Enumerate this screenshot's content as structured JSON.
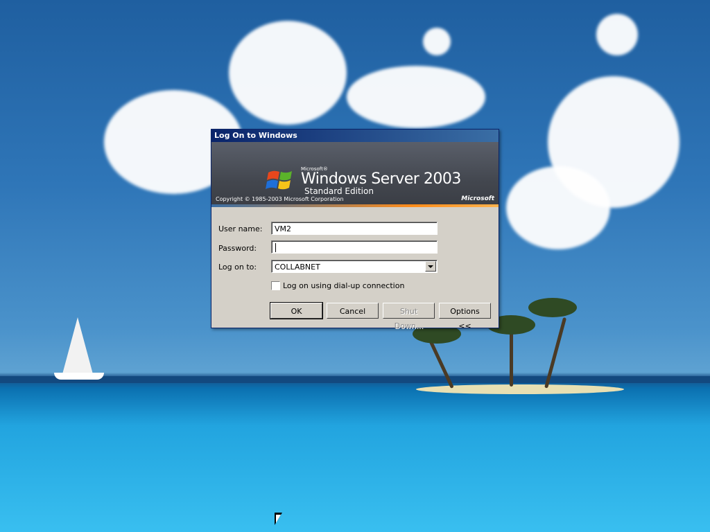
{
  "desktop": {
    "wallpaper": "tropical-island-bliss"
  },
  "dialog": {
    "title": "Log On to Windows",
    "banner": {
      "microsoft_small": "Microsoft®",
      "product": "Windows Server 2003",
      "edition": "Standard Edition",
      "copyright": "Copyright © 1985-2003  Microsoft Corporation",
      "brand": "Microsoft"
    },
    "fields": {
      "username_label": "User name:",
      "username_value": "VM2",
      "password_label": "Password:",
      "password_value": "",
      "logon_to_label": "Log on to:",
      "logon_to_value": "COLLABNET"
    },
    "dialup_label": "Log on using dial-up connection",
    "dialup_checked": false,
    "buttons": {
      "ok": "OK",
      "cancel": "Cancel",
      "shutdown": "Shut Down...",
      "options": "Options <<"
    }
  },
  "colors": {
    "titlebar": "#0a246a",
    "dialog_bg": "#d4d0c8",
    "accent_stripe": "#ff8c1a"
  },
  "icons": [
    "windows-logo-icon",
    "combo-arrow-icon",
    "mouse-cursor-icon"
  ]
}
